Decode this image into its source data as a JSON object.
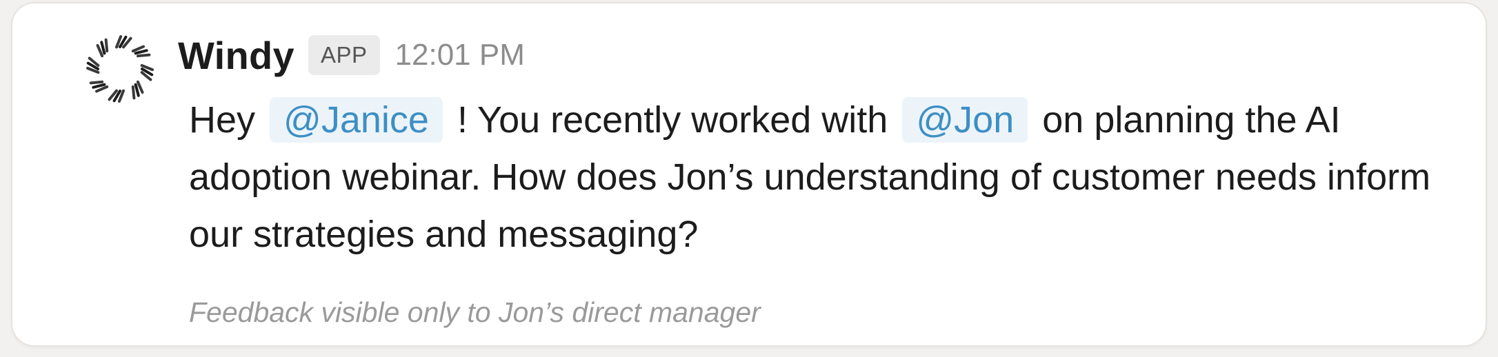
{
  "message": {
    "sender": "Windy",
    "badge": "APP",
    "time": "12:01 PM",
    "text_before_mention1": "Hey",
    "mention1": "@Janice",
    "text_between": "! You recently worked with",
    "mention2": "@Jon",
    "text_after": "on planning the AI adoption webinar. How does Jon’s understanding of customer needs inform our strategies and messaging?"
  },
  "footer": {
    "note": "Feedback visible only to Jon’s direct manager"
  },
  "avatar": {
    "icon": "windy-logo-icon"
  },
  "colors": {
    "mention_text": "#3d8fc4",
    "mention_bg": "#ecf4fa",
    "badge_bg": "#ebebeb",
    "muted_text": "#8c8c8c"
  }
}
